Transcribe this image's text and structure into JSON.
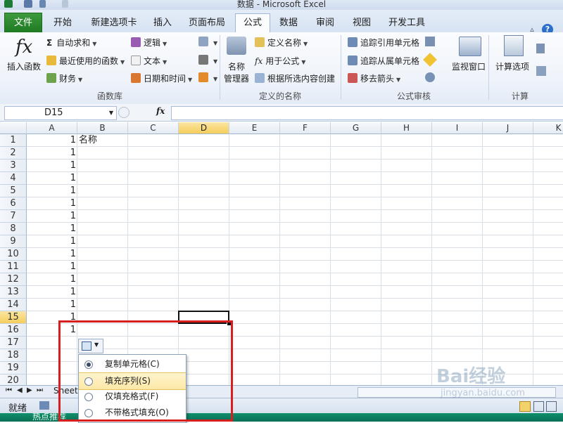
{
  "window": {
    "title": "数据 - Microsoft Excel"
  },
  "ribbon_tabs": [
    "文件",
    "开始",
    "新建选项卡",
    "插入",
    "页面布局",
    "公式",
    "数据",
    "审阅",
    "视图",
    "开发工具"
  ],
  "function_library": {
    "insert_function": "插入函数",
    "autosum": "自动求和",
    "recent": "最近使用的函数",
    "finance": "财务",
    "logic": "逻辑",
    "text": "文本",
    "datetime": "日期和时间",
    "label": "函数库"
  },
  "defined_names": {
    "name_manager_1": "名称",
    "name_manager_2": "管理器",
    "define_name": "定义名称",
    "use_in_formula": "用于公式",
    "create_from_sel": "根据所选内容创建",
    "label": "定义的名称"
  },
  "formula_auditing": {
    "trace_precedents": "追踪引用单元格",
    "trace_dependents": "追踪从属单元格",
    "remove_arrows": "移去箭头",
    "watch_window": "监视窗口",
    "label": "公式审核"
  },
  "calculation": {
    "calc_options": "计算选项",
    "label": "计算"
  },
  "formula_bar": {
    "name_box": "D15",
    "fx": "fx"
  },
  "columns": [
    "A",
    "B",
    "C",
    "D",
    "E",
    "F",
    "G",
    "H",
    "I",
    "J",
    "K"
  ],
  "rows": [
    "1",
    "2",
    "3",
    "4",
    "5",
    "6",
    "7",
    "8",
    "9",
    "10",
    "11",
    "12",
    "13",
    "14",
    "15",
    "16",
    "17",
    "18",
    "19",
    "20"
  ],
  "cells": {
    "A": [
      "1",
      "1",
      "1",
      "1",
      "1",
      "1",
      "1",
      "1",
      "1",
      "1",
      "1",
      "1",
      "1",
      "1",
      "1",
      "1"
    ],
    "B1": "名称"
  },
  "selected_cell": "D15",
  "autofill_menu": {
    "items": [
      "复制单元格(C)",
      "填充序列(S)",
      "仅填充格式(F)",
      "不带格式填充(O)"
    ],
    "selected_index": 0,
    "hover_index": 1
  },
  "sheet_tab": "Sheet",
  "status": {
    "ready": "就绪"
  },
  "taskbar_text": "热点推荐",
  "watermark": {
    "brand": "Bai经验",
    "url": "jingyan.baidu.com"
  }
}
